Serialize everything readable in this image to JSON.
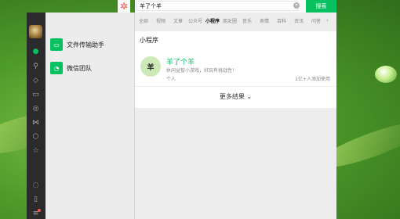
{
  "colors": {
    "brand_green": "#07c160",
    "rail_bg": "#2b2b2d",
    "badge_red": "#fa5151"
  },
  "sidebar": {
    "icons": [
      "chat-icon",
      "contacts-icon",
      "favorites-icon",
      "folder-icon",
      "moments-icon",
      "channels-icon",
      "mini-program-icon",
      "star-icon",
      "phone-icon",
      "phone-icon-2",
      "menu-icon"
    ]
  },
  "chats": [
    {
      "name": "文件传输助手",
      "icon": "folder-icon"
    },
    {
      "name": "微信团队",
      "icon": "wechat-icon"
    }
  ],
  "search": {
    "query": "羊了个羊",
    "button_label": "搜索",
    "tabs": [
      "全部",
      "视频",
      "文章",
      "公众号",
      "小程序",
      "朋友圈",
      "音乐",
      "表情",
      "百科",
      "资讯",
      "问答"
    ],
    "active_tab": 4,
    "more_tabs_icon": "chevron-right-icon"
  },
  "result": {
    "section_title": "小程序",
    "logo_text": "羊",
    "app_name": "羊了个羊",
    "description": "休闲益智小游戏，好玩有挑战性！",
    "owner": "个人",
    "users": "1亿+人添加使用",
    "more_label": "更多结果"
  }
}
